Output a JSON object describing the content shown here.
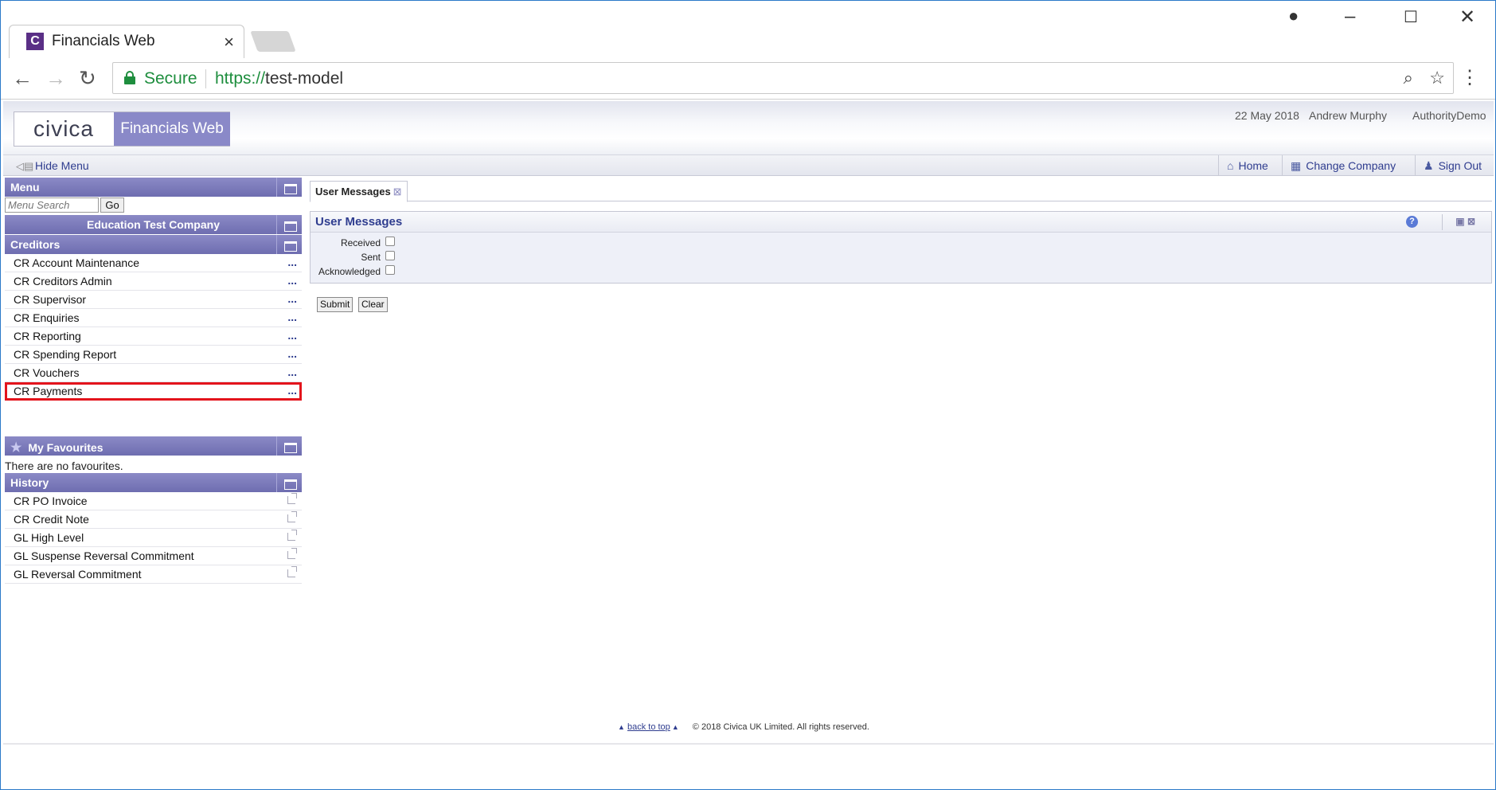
{
  "browser": {
    "tab_title": "Financials Web",
    "tab_favicon": "C",
    "secure_label": "Secure",
    "url_scheme": "https://",
    "url_host": "test-model"
  },
  "header": {
    "logo_brand": "civica",
    "logo_product": "Financials Web",
    "date": "22 May 2018",
    "user": "Andrew Murphy",
    "authority": "AuthorityDemo"
  },
  "navbar": {
    "hide_menu": "Hide Menu",
    "home": "Home",
    "change_company": "Change Company",
    "sign_out": "Sign Out"
  },
  "menu": {
    "title": "Menu",
    "search_placeholder": "Menu Search",
    "go_label": "Go",
    "company": "Education Test Company",
    "section": "Creditors",
    "items": [
      {
        "label": "CR Account Maintenance"
      },
      {
        "label": "CR Creditors Admin"
      },
      {
        "label": "CR Supervisor"
      },
      {
        "label": "CR Enquiries"
      },
      {
        "label": "CR Reporting"
      },
      {
        "label": "CR Spending Report"
      },
      {
        "label": "CR Vouchers"
      },
      {
        "label": "CR Payments"
      }
    ],
    "dots": "..."
  },
  "favourites": {
    "title": "My Favourites",
    "empty_text": "There are no favourites."
  },
  "history": {
    "title": "History",
    "items": [
      {
        "label": "CR PO Invoice"
      },
      {
        "label": "CR Credit Note"
      },
      {
        "label": "GL High Level"
      },
      {
        "label": "GL Suspense Reversal Commitment"
      },
      {
        "label": "GL Reversal Commitment"
      }
    ]
  },
  "main": {
    "tab_label": "User Messages",
    "panel_title": "User Messages",
    "fields": [
      {
        "label": "Received"
      },
      {
        "label": "Sent"
      },
      {
        "label": "Acknowledged"
      }
    ],
    "submit_label": "Submit",
    "clear_label": "Clear"
  },
  "footer": {
    "back_to_top": "back to top",
    "copyright": "© 2018 Civica UK Limited. All rights reserved."
  }
}
